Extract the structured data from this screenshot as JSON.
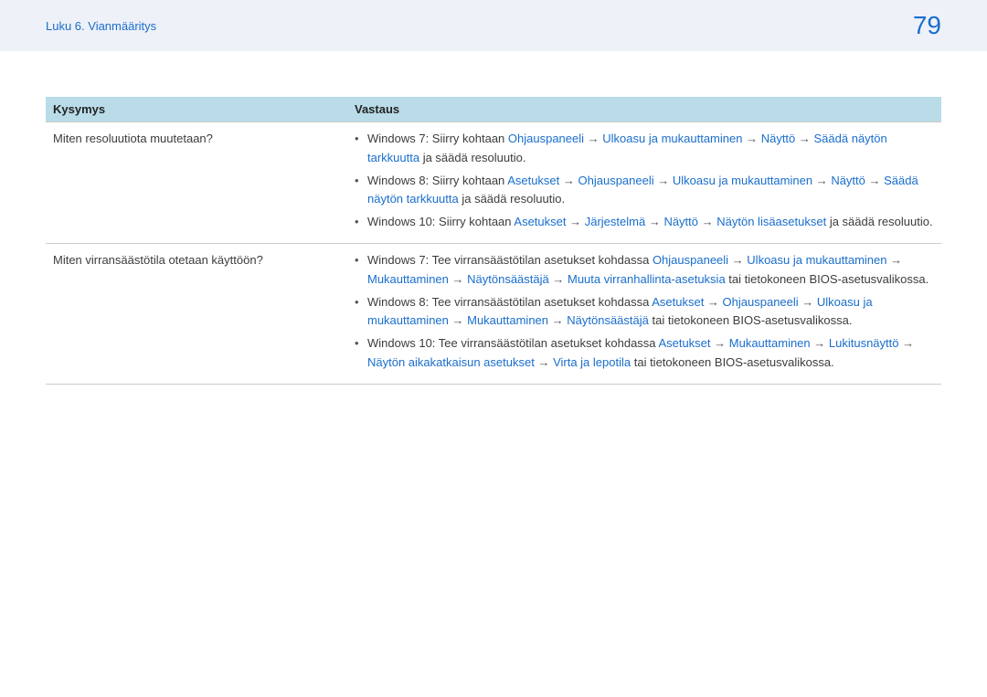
{
  "header": {
    "breadcrumb": "Luku 6. Vianmääritys",
    "page_number": "79"
  },
  "table": {
    "headers": {
      "question": "Kysymys",
      "answer": "Vastaus"
    },
    "rows": [
      {
        "question": "Miten resoluutiota muutetaan?",
        "answers": [
          {
            "prefix": "Windows 7: Siirry kohtaan ",
            "path": [
              "Ohjauspaneeli",
              "Ulkoasu ja mukauttaminen",
              "Näyttö",
              "Säädä näytön tarkkuutta"
            ],
            "suffix": " ja säädä resoluutio."
          },
          {
            "prefix": "Windows 8: Siirry kohtaan ",
            "path": [
              "Asetukset",
              "Ohjauspaneeli",
              "Ulkoasu ja mukauttaminen",
              "Näyttö",
              "Säädä näytön tarkkuutta"
            ],
            "suffix": " ja säädä resoluutio."
          },
          {
            "prefix": "Windows 10: Siirry kohtaan ",
            "path": [
              "Asetukset",
              "Järjestelmä",
              "Näyttö",
              "Näytön lisäasetukset"
            ],
            "suffix": " ja säädä resoluutio."
          }
        ]
      },
      {
        "question": "Miten virransäästötila otetaan käyttöön?",
        "answers": [
          {
            "prefix": "Windows 7: Tee virransäästötilan asetukset kohdassa ",
            "path": [
              "Ohjauspaneeli",
              "Ulkoasu ja mukauttaminen",
              "Mukauttaminen",
              "Näytönsäästäjä",
              "Muuta virranhallinta-asetuksia"
            ],
            "suffix": " tai tietokoneen BIOS-asetusvalikossa."
          },
          {
            "prefix": "Windows 8: Tee virransäästötilan asetukset kohdassa ",
            "path": [
              "Asetukset",
              "Ohjauspaneeli",
              "Ulkoasu ja mukauttaminen",
              "Mukauttaminen",
              "Näytönsäästäjä"
            ],
            "suffix": " tai tietokoneen BIOS-asetusvalikossa."
          },
          {
            "prefix": "Windows 10: Tee virransäästötilan asetukset kohdassa ",
            "path": [
              "Asetukset",
              "Mukauttaminen",
              "Lukitusnäyttö",
              "Näytön aikakatkaisun asetukset",
              "Virta ja lepotila"
            ],
            "suffix": " tai tietokoneen BIOS-asetusvalikossa."
          }
        ]
      }
    ]
  },
  "arrow_glyph": "→"
}
